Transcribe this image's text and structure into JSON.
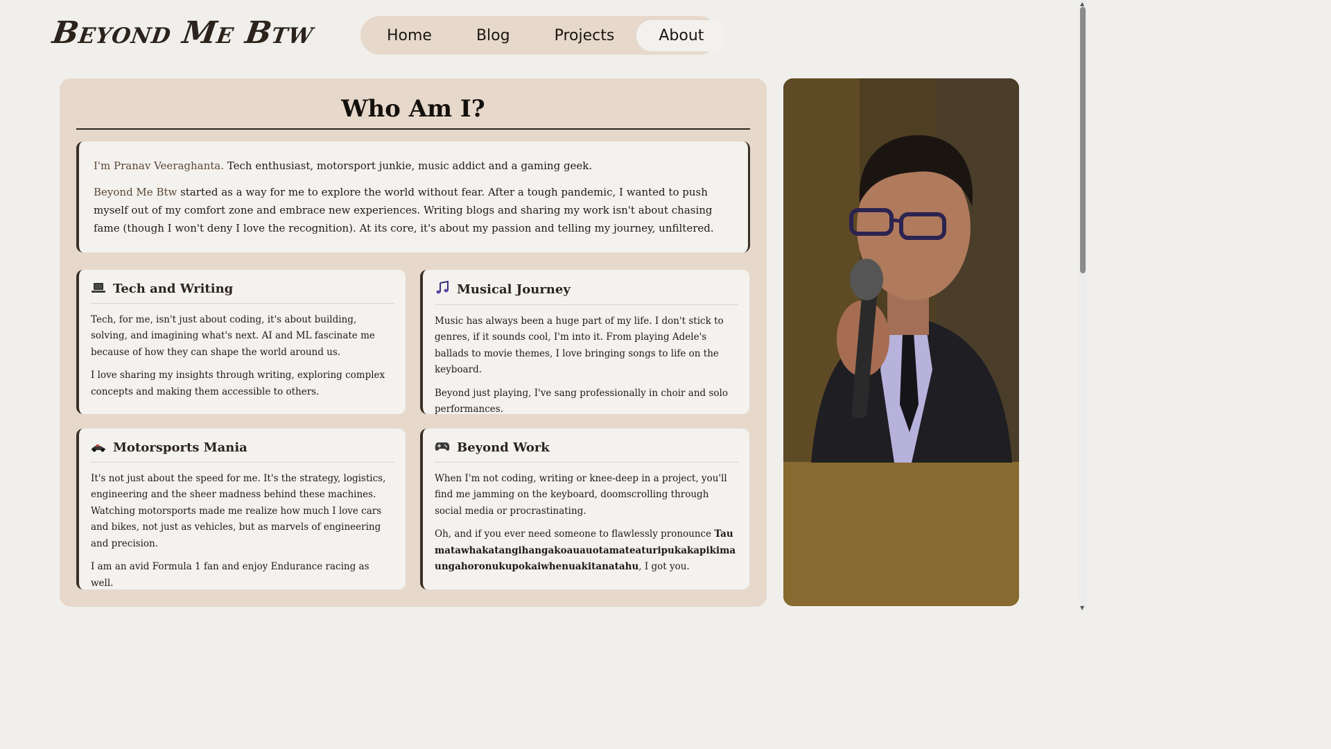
{
  "site": {
    "title": "Beyond Me Btw"
  },
  "nav": {
    "items": [
      {
        "label": "Home"
      },
      {
        "label": "Blog"
      },
      {
        "label": "Projects"
      },
      {
        "label": "About",
        "active": true
      }
    ]
  },
  "main": {
    "title": "Who Am I?",
    "intro": {
      "p1_name": "I'm Pranav Veeraghanta.",
      "p1_rest": " Tech enthusiast, motorsport junkie, music addict and a gaming geek.",
      "p2_brand": "Beyond Me Btw",
      "p2_rest": " started as a way for me to explore the world without fear. After a tough pandemic, I wanted to push myself out of my comfort zone and embrace new experiences. Writing blogs and sharing my work isn't about chasing fame (though I won't deny I love the recognition). At its core, it's about my passion and telling my journey, unfiltered."
    },
    "cards": [
      {
        "icon": "laptop-icon",
        "title": "Tech and Writing",
        "p1": "Tech, for me, isn't just about coding, it's about building, solving, and imagining what's next. AI and ML fascinate me because of how they can shape the world around us.",
        "p2": "I love sharing my insights through writing, exploring complex concepts and making them accessible to others."
      },
      {
        "icon": "music-note-icon",
        "title": "Musical Journey",
        "p1": "Music has always been a huge part of my life. I don't stick to genres, if it sounds cool, I'm into it. From playing Adele's ballads to movie themes, I love bringing songs to life on the keyboard.",
        "p2": "Beyond just playing, I've sang professionally in choir and solo performances."
      },
      {
        "icon": "race-car-icon",
        "title": "Motorsports Mania",
        "p1": "It's not just about the speed for me. It's the strategy, logistics, engineering and the sheer madness behind these machines. Watching motorsports made me realize how much I love cars and bikes, not just as vehicles, but as marvels of engineering and precision.",
        "p2": "I am an avid Formula 1 fan and enjoy Endurance racing as well."
      },
      {
        "icon": "gamepad-icon",
        "title": "Beyond Work",
        "p1": "When I'm not coding, writing or knee-deep in a project, you'll find me jamming on the keyboard, doomscrolling through social media or procrastinating.",
        "p2_pre": "Oh, and if you ever need someone to flawlessly pronounce ",
        "p2_word": "Taumatawhakatangihangakoauauotamateaturipukakapikimaungahoronukupokaiwhenuakitanatahu",
        "p2_post": ", I got you."
      }
    ]
  },
  "photo": {
    "icon": "portrait-photo"
  },
  "colors": {
    "background": "#f1efeb",
    "panel": "#e6d9cc",
    "card": "#f4f2ee",
    "accent": "#3a2f26"
  }
}
